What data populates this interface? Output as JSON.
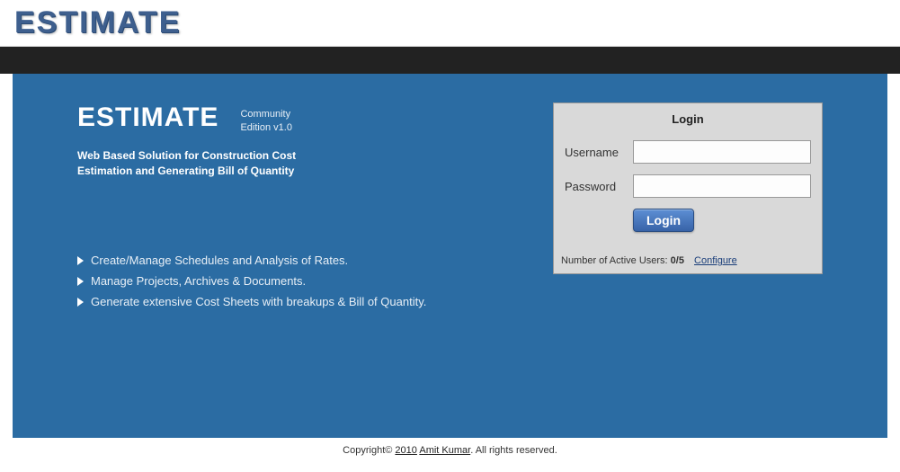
{
  "header": {
    "logo": "ESTIMATE"
  },
  "hero": {
    "title": "ESTIMATE",
    "edition_line1": "Community",
    "edition_line2": "Edition v1.0",
    "tagline_line1": "Web Based Solution for Construction Cost",
    "tagline_line2": "Estimation and Generating Bill of Quantity"
  },
  "features": {
    "0": "Create/Manage Schedules and Analysis of Rates.",
    "1": "Manage Projects, Archives & Documents.",
    "2": "Generate extensive Cost Sheets with breakups & Bill of Quantity."
  },
  "login": {
    "heading": "Login",
    "username_label": "Username",
    "password_label": "Password",
    "username_value": "",
    "password_value": "",
    "button_label": "Login",
    "active_users_prefix": "Number of Active Users: ",
    "active_users_count": "0/5",
    "configure_label": "Configure"
  },
  "footer": {
    "prefix": "Copyright© ",
    "year": "2010",
    "space": " ",
    "author": "Amit Kumar",
    "suffix": ". All rights reserved."
  }
}
